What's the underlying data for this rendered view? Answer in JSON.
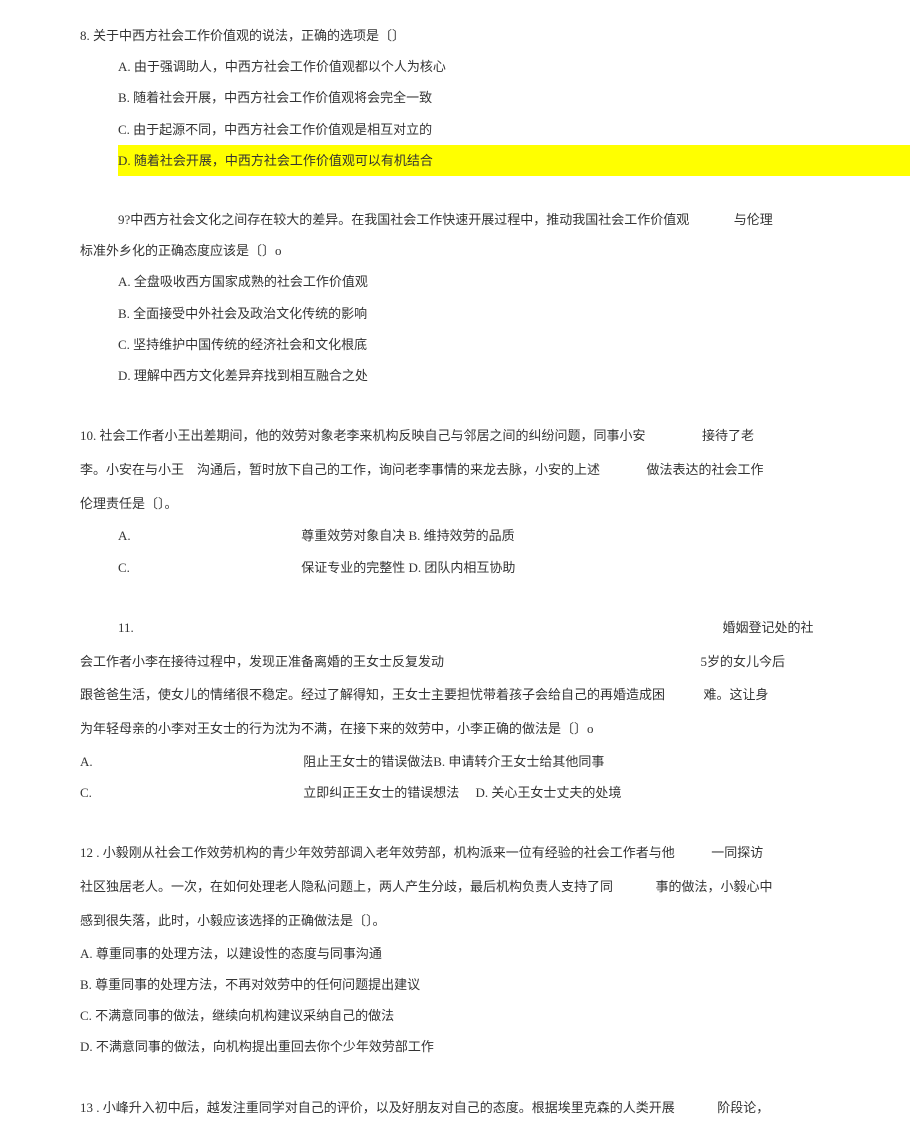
{
  "q8": {
    "stem": "8. 关于中西方社会工作价值观的说法，正确的选项是〔〕",
    "optA": "A. 由于强调助人，中西方社会工作价值观都以个人为核心",
    "optB": "B. 随着社会开展，中西方社会工作价值观将会完全一致",
    "optC": "C. 由于起源不同，中西方社会工作价值观是相互对立的",
    "optD": "D. 随着社会开展，中西方社会工作价值观可以有机结合"
  },
  "q9": {
    "stem_line1a": "9?中西方社会文化之间存在较大的差异。在我国社会工作快速开展过程中，推动我国社会工作价值观",
    "stem_line1b": "与伦理",
    "stem_line2": "标准外乡化的正确态度应该是〔〕o",
    "optA": "A. 全盘吸收西方国家成熟的社会工作价值观",
    "optB": "B. 全面接受中外社会及政治文化传统的影响",
    "optC": "C. 坚持维护中国传统的经济社会和文化根底",
    "optD": "D. 理解中西方文化差异弃找到相互融合之处"
  },
  "q10": {
    "stem_l1a": "10. 社会工作者小王出差期间，他的效劳对象老李来机构反映自己与邻居之间的纠纷问题，同事小安",
    "stem_l1b": "接待了老",
    "stem_l2a": "李。小安在与小王　沟通后，暂时放下自己的工作，询问老李事情的来龙去脉，小安的上述",
    "stem_l2b": "做法表达的社会工作",
    "stem_l3": "伦理责任是〔〕。",
    "row1_lblA": "A.",
    "row1_txt": "尊重效劳对象自决 B. 维持效劳的品质",
    "row2_lblC": "C.",
    "row2_txt": "保证专业的完整性 D. 团队内相互协助"
  },
  "q11": {
    "num": "11.",
    "l1_right": "婚姻登记处的社",
    "l2_left": "会工作者小李在接待过程中，发现正准备离婚的王女士反复发动",
    "l2_right": "5岁的女儿今后",
    "l3_left": "跟爸爸生活，使女儿的情绪很不稳定。经过了解得知，王女士主要担忧带着孩子会给自己的再婚造成困",
    "l3_right": "难。这让身",
    "l4": "为年轻母亲的小李对王女士的行为沈为不满，在接下来的效劳中，小李正确的做法是〔〕o",
    "row1_lblA": "A.",
    "row1_txt": "阻止王女士的错误做法B. 申请转介王女士给其他同事",
    "row2_lblC": "C.",
    "row2_txt": "立即纠正王女士的错误想法　 D. 关心王女士丈夫的处境"
  },
  "q12": {
    "l1a": "12 . 小毅刚从社会工作效劳机构的青少年效劳部调入老年效劳部，机构派来一位有经验的社会工作者与他",
    "l1b": "一同探访",
    "l2a": "社区独居老人。一次，在如何处理老人隐私问题上，两人产生分歧，最后机构负责人支持了同",
    "l2b": "事的做法，小毅心中",
    "l3": "感到很失落，此时，小毅应该选择的正确做法是〔〕。",
    "optA": "A. 尊重同事的处理方法，以建设性的态度与同事沟通",
    "optB": "B. 尊重同事的处理方法，不再对效劳中的任何问题提出建议",
    "optC": "C. 不满意同事的做法，继续向机构建议采纳自己的做法",
    "optD": "D. 不满意同事的做法，向机构提出重回去你个少年效劳部工作"
  },
  "q13": {
    "l1a": "13 . 小峰升入初中后，越发注重同学对自己的评价，以及好朋友对自己的态度。根据埃里克森的人类开展",
    "l1b": "阶段论，"
  }
}
